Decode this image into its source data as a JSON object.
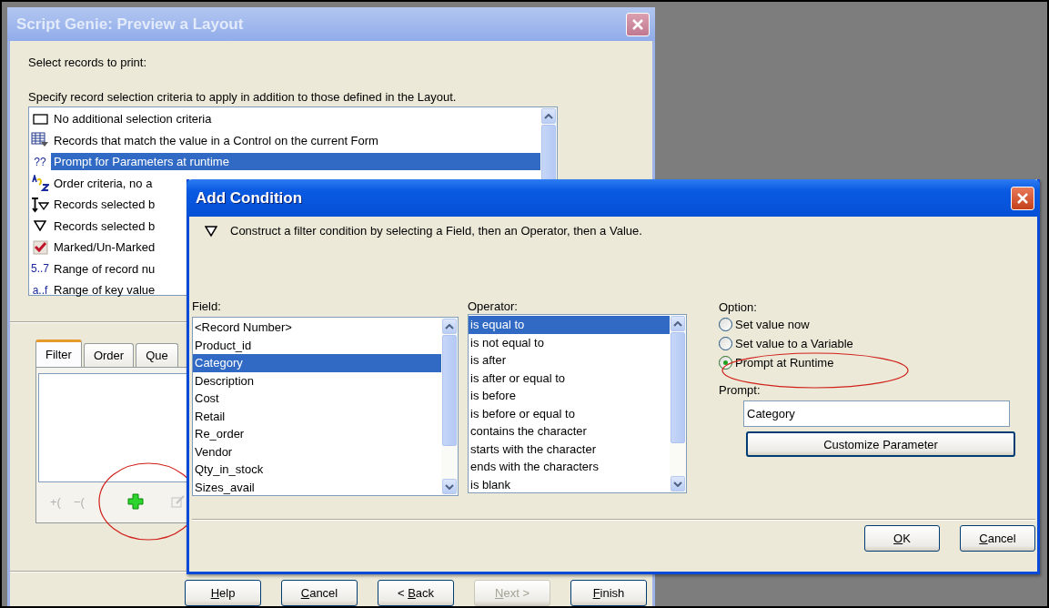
{
  "main_window": {
    "title": "Script Genie:  Preview a Layout",
    "prompt_label": "Select records to print:",
    "criteria_label": "Specify record selection criteria to apply in addition to those defined in the Layout.",
    "criteria": [
      {
        "kind": "box",
        "label": "No additional selection criteria",
        "selected": false
      },
      {
        "kind": "grid",
        "label": "Records that match the value in a Control on the current Form",
        "selected": false
      },
      {
        "kind": "text",
        "glyph": "??",
        "label": "Prompt for Parameters at runtime",
        "selected": true
      },
      {
        "kind": "az",
        "label": "Order criteria, no a",
        "selected": false
      },
      {
        "kind": "sortfilter",
        "label": "Records selected b",
        "selected": false
      },
      {
        "kind": "filter",
        "label": "Records selected b",
        "selected": false
      },
      {
        "kind": "check",
        "label": "Marked/Un-Marked",
        "selected": false
      },
      {
        "kind": "text",
        "glyph": "5..7",
        "label": "Range of record nu",
        "selected": false
      },
      {
        "kind": "text",
        "glyph": "a..f",
        "label": "Range of key value",
        "selected": false
      }
    ],
    "tabs": [
      {
        "label": "Filter",
        "selected": true
      },
      {
        "label": "Order",
        "selected": false
      },
      {
        "label": "Que",
        "selected": false
      }
    ],
    "toolbar": [
      {
        "kind": "text",
        "label": "+(",
        "disabled": true
      },
      {
        "kind": "text",
        "label": "−(",
        "disabled": true
      },
      {
        "kind": "add",
        "disabled": false
      },
      {
        "kind": "edit",
        "disabled": true
      }
    ],
    "buttons": [
      {
        "key": "H",
        "after": "elp",
        "disabled": false
      },
      {
        "key": "C",
        "after": "ancel",
        "disabled": false
      },
      {
        "before": "< ",
        "key": "B",
        "after": "ack",
        "disabled": false
      },
      {
        "key": "N",
        "after": "ext >",
        "disabled": true
      },
      {
        "key": "F",
        "after": "inish",
        "disabled": false
      }
    ]
  },
  "dialog": {
    "title": "Add Condition",
    "description": "Construct a filter condition by selecting a Field, then an Operator, then a Value.",
    "field_label": "Field:",
    "fields": [
      {
        "label": "<Record Number>",
        "selected": false
      },
      {
        "label": "Product_id",
        "selected": false
      },
      {
        "label": "Category",
        "selected": true
      },
      {
        "label": "Description",
        "selected": false
      },
      {
        "label": "Cost",
        "selected": false
      },
      {
        "label": "Retail",
        "selected": false
      },
      {
        "label": "Re_order",
        "selected": false
      },
      {
        "label": "Vendor",
        "selected": false
      },
      {
        "label": "Qty_in_stock",
        "selected": false
      },
      {
        "label": "Sizes_avail",
        "selected": false
      }
    ],
    "operator_label": "Operator:",
    "operators": [
      {
        "label": "is equal to",
        "selected": true
      },
      {
        "label": "is not equal to",
        "selected": false
      },
      {
        "label": "is after",
        "selected": false
      },
      {
        "label": "is after or equal to",
        "selected": false
      },
      {
        "label": "is before",
        "selected": false
      },
      {
        "label": "is before or equal to",
        "selected": false
      },
      {
        "label": "contains the character",
        "selected": false
      },
      {
        "label": "starts with the character",
        "selected": false
      },
      {
        "label": "ends with the characters",
        "selected": false
      },
      {
        "label": "is blank",
        "selected": false
      }
    ],
    "option_label": "Option:",
    "options": [
      {
        "label": "Set value now",
        "selected": false
      },
      {
        "label": "Set value to a Variable",
        "selected": false
      },
      {
        "label": "Prompt at Runtime",
        "selected": true
      }
    ],
    "prompt_label": "Prompt:",
    "prompt_value": "Category",
    "customize_button": "Customize Parameter",
    "buttons": [
      {
        "key": "O",
        "after": "K",
        "disabled": false
      },
      {
        "key": "C",
        "after": "ancel",
        "disabled": false
      }
    ]
  }
}
